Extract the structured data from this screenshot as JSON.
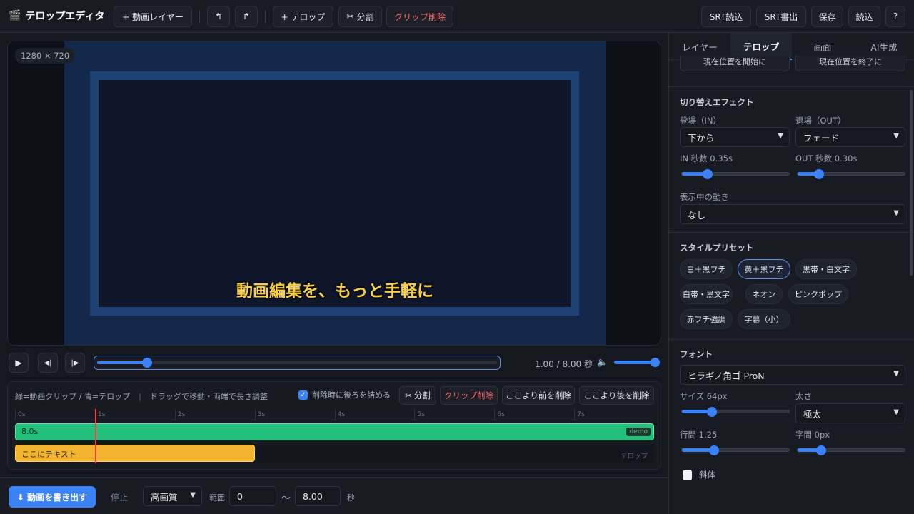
{
  "app": {
    "title": "テロップエディタ",
    "logo_glyph": "🎬"
  },
  "toolbar": {
    "add_layer": "+ 動画レイヤー",
    "undo": "↰",
    "redo": "↱",
    "add_telop": "+ テロップ",
    "split": "分割",
    "delete_clip": "クリップ削除",
    "srt_import": "SRT読込",
    "srt_export": "SRT書出",
    "save": "保存",
    "load": "読込",
    "help": "?"
  },
  "preview": {
    "size_badge": "1280 × 720",
    "telop_text": "動画編集を、もっと手軽に"
  },
  "transport": {
    "play": "▶",
    "step_back": "◀|",
    "step_forward": "|▶",
    "time_readout": "1.00 / 8.00 秒",
    "volume_icon": "🔈",
    "position_fraction": 0.125,
    "volume_fraction": 1.0
  },
  "timeline": {
    "hint": "緑=動画クリップ / 青=テロップ",
    "hint2": "ドラッグで移動・両端で長さ調整",
    "close_gap_label": "削除時に後ろを詰める",
    "close_gap_checked": true,
    "split": "分割",
    "delete_clip": "クリップ削除",
    "delete_before": "ここより前を削除",
    "delete_after": "ここより後を削除",
    "ticks": [
      "0s",
      "1s",
      "2s",
      "3s",
      "4s",
      "5s",
      "6s",
      "7s"
    ],
    "video_clip_label": "8.0s",
    "video_clip_tag": "demo",
    "telop_clip_label": "ここにテキスト",
    "telop_track_tag": "テロップ",
    "telop_end_sec": 3,
    "playhead_sec": 1,
    "duration_sec": 8
  },
  "export_bar": {
    "export": "⬇ 動画を書き出す",
    "stop": "停止",
    "quality": "高画質",
    "range_label": "範囲",
    "range_start": "0",
    "range_sep": "〜",
    "range_end": "8.00",
    "unit": "秒"
  },
  "panel": {
    "tabs": [
      "レイヤー",
      "テロップ",
      "画面",
      "AI生成"
    ],
    "active_tab": 1,
    "set_start": "現在位置を開始に",
    "set_end": "現在位置を終了に",
    "transition_title": "切り替えエフェクト",
    "in_label": "登場（IN）",
    "in_value": "下から",
    "out_label": "退場（OUT）",
    "out_value": "フェード",
    "in_sec_label": "IN 秒数 0.35s",
    "out_sec_label": "OUT 秒数 0.30s",
    "in_sec_fraction": 0.24,
    "out_sec_fraction": 0.2,
    "motion_label": "表示中の動き",
    "motion_value": "なし",
    "preset_title": "スタイルプリセット",
    "presets": [
      "白＋黒フチ",
      "黄＋黒フチ",
      "黒帯・白文字",
      "白帯・黒文字",
      "ネオン",
      "ピンクポップ",
      "赤フチ強調",
      "字幕（小）"
    ],
    "active_preset": 1,
    "font_title": "フォント",
    "font_value": "ヒラギノ角ゴ ProN",
    "size_label": "サイズ 64px",
    "size_fraction": 0.28,
    "weight_label": "太さ",
    "weight_value": "極太",
    "line_height_label": "行間 1.25",
    "line_height_fraction": 0.3,
    "letter_spacing_label": "字間 0px",
    "letter_spacing_fraction": 0.22,
    "italic_label": "斜体"
  }
}
